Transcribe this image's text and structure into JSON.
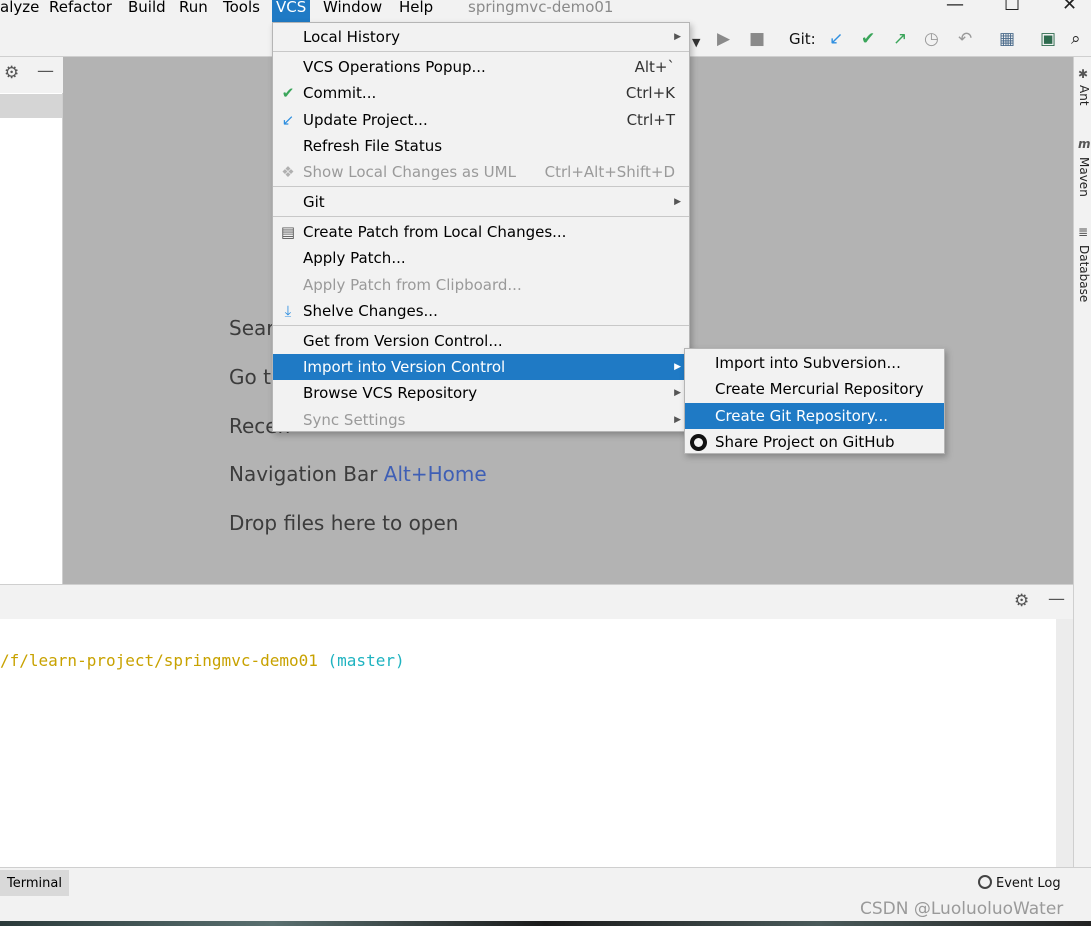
{
  "menubar": {
    "items": [
      "alyze",
      "Refactor",
      "Build",
      "Run",
      "Tools",
      "VCS",
      "Window",
      "Help"
    ],
    "project_title": "springmvc-demo01"
  },
  "toolbar": {
    "git_label": "Git:",
    "icons": [
      "dropdown-arrow-icon",
      "run-icon",
      "stop-icon",
      "git-update-icon",
      "git-commit-icon",
      "git-push-icon",
      "history-icon",
      "rollback-icon",
      "project-structure-icon",
      "run-anything-icon",
      "search-icon"
    ]
  },
  "editor": {
    "hints": [
      {
        "text": "Sear",
        "shortcut": ""
      },
      {
        "text": "Go t",
        "shortcut": ""
      },
      {
        "text": "Recen",
        "shortcut": ""
      },
      {
        "text": "Navigation Bar ",
        "shortcut": "Alt+Home"
      },
      {
        "text": "Drop files here to open",
        "shortcut": ""
      }
    ]
  },
  "right_tools": [
    "Ant",
    "Maven",
    "Database"
  ],
  "vcs_menu": {
    "items": [
      {
        "label": "Local History",
        "shortcut": "",
        "submenu": true,
        "disabled": false,
        "icon": ""
      },
      {
        "label": "VCS Operations Popup...",
        "shortcut": "Alt+`",
        "submenu": false,
        "disabled": false,
        "icon": ""
      },
      {
        "label": "Commit...",
        "shortcut": "Ctrl+K",
        "submenu": false,
        "disabled": false,
        "icon": "check-icon"
      },
      {
        "label": "Update Project...",
        "shortcut": "Ctrl+T",
        "submenu": false,
        "disabled": false,
        "icon": "update-arrow-icon"
      },
      {
        "label": "Refresh File Status",
        "shortcut": "",
        "submenu": false,
        "disabled": false,
        "icon": ""
      },
      {
        "label": "Show Local Changes as UML",
        "shortcut": "Ctrl+Alt+Shift+D",
        "submenu": false,
        "disabled": true,
        "icon": "uml-icon"
      },
      {
        "label": "Git",
        "shortcut": "",
        "submenu": true,
        "disabled": false,
        "icon": ""
      },
      {
        "label": "Create Patch from Local Changes...",
        "shortcut": "",
        "submenu": false,
        "disabled": false,
        "icon": "patch-icon"
      },
      {
        "label": "Apply Patch...",
        "shortcut": "",
        "submenu": false,
        "disabled": false,
        "icon": ""
      },
      {
        "label": "Apply Patch from Clipboard...",
        "shortcut": "",
        "submenu": false,
        "disabled": true,
        "icon": ""
      },
      {
        "label": "Shelve Changes...",
        "shortcut": "",
        "submenu": false,
        "disabled": false,
        "icon": "shelve-icon"
      },
      {
        "label": "Get from Version Control...",
        "shortcut": "",
        "submenu": false,
        "disabled": false,
        "icon": ""
      },
      {
        "label": "Import into Version Control",
        "shortcut": "",
        "submenu": true,
        "disabled": false,
        "icon": "",
        "selected": true
      },
      {
        "label": "Browse VCS Repository",
        "shortcut": "",
        "submenu": true,
        "disabled": false,
        "icon": ""
      },
      {
        "label": "Sync Settings",
        "shortcut": "",
        "submenu": true,
        "disabled": true,
        "icon": ""
      }
    ]
  },
  "import_submenu": {
    "items": [
      {
        "label": "Import into Subversion...",
        "icon": ""
      },
      {
        "label": "Create Mercurial Repository",
        "icon": ""
      },
      {
        "label": "Create Git Repository...",
        "icon": "",
        "selected": true
      },
      {
        "label": "Share Project on GitHub",
        "icon": "github-icon"
      }
    ]
  },
  "terminal": {
    "path": "/f/learn-project/springmvc-demo01",
    "branch": "(master)"
  },
  "statusbar": {
    "terminal_tab": "Terminal",
    "event_log": "Event Log"
  },
  "watermark": "CSDN @LuoluoluoWater",
  "colors": {
    "accent": "#1f7ac5",
    "editor_bg": "#b3b3b3",
    "shortcut_link": "#3f5fb5",
    "terminal_path": "#c8a200",
    "terminal_branch": "#1fb3c0"
  }
}
